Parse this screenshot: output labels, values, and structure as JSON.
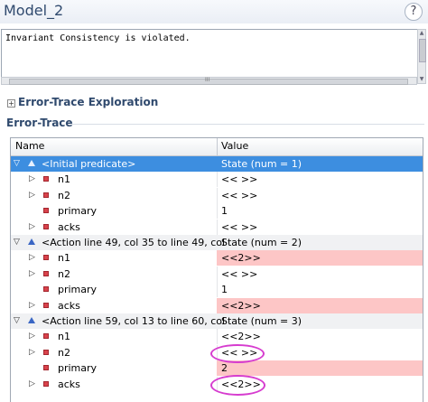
{
  "window": {
    "title": "Model_2",
    "help_label": "?"
  },
  "message": {
    "text": "Invariant Consistency is violated."
  },
  "scroll": {
    "grip": "III"
  },
  "sections": {
    "exploration": {
      "label": "Error-Trace Exploration",
      "toggle": "+"
    },
    "trace": {
      "label": "Error-Trace"
    }
  },
  "table": {
    "columns": {
      "name": "Name",
      "value": "Value"
    },
    "states": [
      {
        "name": "<Initial predicate>",
        "value": "State (num = 1)",
        "vars": [
          {
            "name": "n1",
            "value": "<< >>",
            "changed": false
          },
          {
            "name": "n2",
            "value": "<< >>",
            "changed": false
          },
          {
            "name": "primary",
            "value": "1",
            "changed": false
          },
          {
            "name": "acks",
            "value": "<< >>",
            "changed": false
          }
        ]
      },
      {
        "name": "<Action line 49, col 35 to line 49, col",
        "value": "State (num = 2)",
        "vars": [
          {
            "name": "n1",
            "value": "<<2>>",
            "changed": true
          },
          {
            "name": "n2",
            "value": "<< >>",
            "changed": false
          },
          {
            "name": "primary",
            "value": "1",
            "changed": false
          },
          {
            "name": "acks",
            "value": "<<2>>",
            "changed": true
          }
        ]
      },
      {
        "name": "<Action line 59, col 13 to line 60, col",
        "value": "State (num = 3)",
        "vars": [
          {
            "name": "n1",
            "value": "<<2>>",
            "changed": false
          },
          {
            "name": "n2",
            "value": "<< >>",
            "changed": false
          },
          {
            "name": "primary",
            "value": "2",
            "changed": true
          },
          {
            "name": "acks",
            "value": "<<2>>",
            "changed": false
          }
        ]
      }
    ]
  },
  "colors": {
    "selected": "#3d8ee0",
    "changed": "#fdc6c6",
    "annotation": "#d63ccf"
  }
}
